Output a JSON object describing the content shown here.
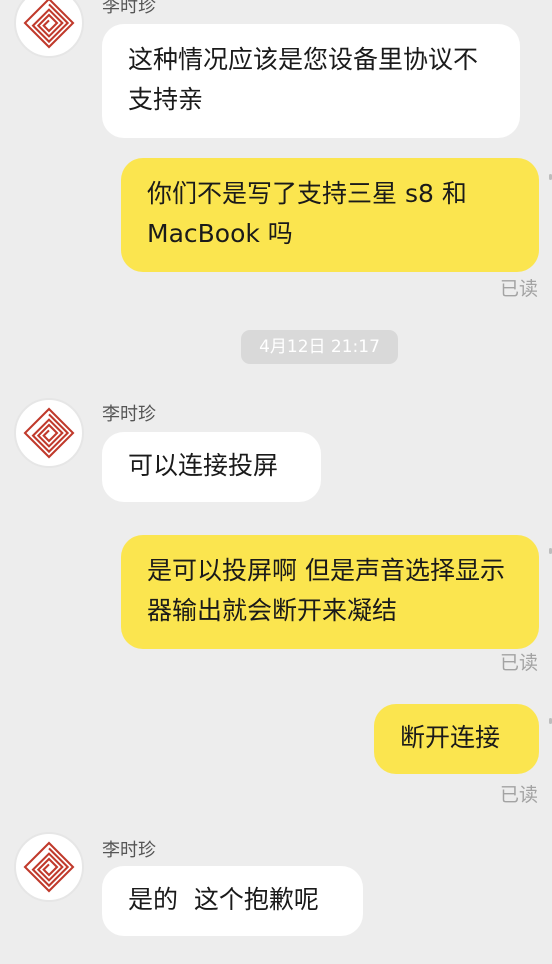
{
  "messages": [
    {
      "sender": "李时珍",
      "text": "这种情况应该是您设备里协议不支持亲"
    },
    {
      "text": "你们不是写了支持三星 s8 和 MacBook 吗",
      "status": "已读"
    },
    {
      "timestamp": "4月12日 21:17"
    },
    {
      "sender": "李时珍",
      "text": "可以连接投屏"
    },
    {
      "text": "是可以投屏啊 但是声音选择显示器输出就会断开来凝结",
      "status": "已读"
    },
    {
      "text": "断开连接",
      "status": "已读"
    },
    {
      "sender": "李时珍",
      "text": "是的  这个抱歉呢"
    }
  ],
  "colors": {
    "background": "#EDEDED",
    "incoming_bubble": "#FFFFFF",
    "outgoing_bubble": "#FBE54F",
    "avatar_mark": "#C0392B"
  },
  "icons": {
    "avatar": "red-maze-logo-icon"
  }
}
